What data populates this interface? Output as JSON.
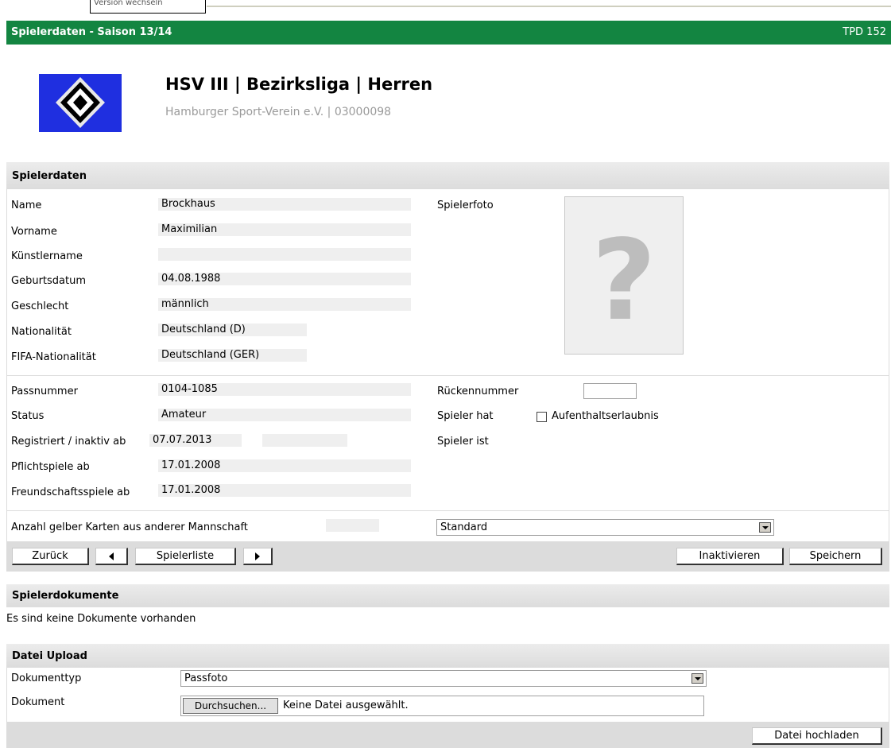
{
  "header": {
    "top_tab_text": "Version wechseln",
    "title": "Spielerdaten - Saison 13/14",
    "code": "TPD 152"
  },
  "club": {
    "name": "HSV III | Bezirksliga | Herren",
    "sub": "Hamburger Sport-Verein e.V. | 03000098"
  },
  "spielerdaten": {
    "heading": "Spielerdaten",
    "fields": {
      "name": {
        "label": "Name",
        "value": "Brockhaus"
      },
      "vorname": {
        "label": "Vorname",
        "value": "Maximilian"
      },
      "kuenstlername": {
        "label": "Künstlername",
        "value": ""
      },
      "geburtsdatum": {
        "label": "Geburtsdatum",
        "value": "04.08.1988"
      },
      "geschlecht": {
        "label": "Geschlecht",
        "value": "männlich"
      },
      "nationalitaet": {
        "label": "Nationalität",
        "value": "Deutschland (D)"
      },
      "fifa_nationalitaet": {
        "label": "FIFA-Nationalität",
        "value": "Deutschland (GER)"
      },
      "passnummer": {
        "label": "Passnummer",
        "value": "0104-1085"
      },
      "status": {
        "label": "Status",
        "value": "Amateur"
      },
      "registriert": {
        "label": "Registriert / inaktiv ab",
        "value": "07.07.2013",
        "value2": ""
      },
      "pflichtspiele": {
        "label": "Pflichtspiele ab",
        "value": "17.01.2008"
      },
      "freundschaftsspiele": {
        "label": "Freundschaftsspiele ab",
        "value": "17.01.2008"
      },
      "gelbe_karten": {
        "label": "Anzahl gelber Karten aus anderer Mannschaft",
        "value": ""
      }
    },
    "spielerfoto_label": "Spielerfoto",
    "photo_placeholder": "?",
    "rueckennummer": {
      "label": "Rückennummer",
      "value": ""
    },
    "spieler_hat": {
      "label": "Spieler hat",
      "checkbox_label": "Aufenthaltserlaubnis",
      "checked": false
    },
    "spieler_ist": {
      "label": "Spieler ist"
    },
    "karten_select": {
      "selected": "Standard"
    }
  },
  "toolbar": {
    "zurueck": "Zurück",
    "spielerliste": "Spielerliste",
    "inaktivieren": "Inaktivieren",
    "speichern": "Speichern"
  },
  "dokumente": {
    "heading": "Spielerdokumente",
    "empty_text": "Es sind keine Dokumente vorhanden"
  },
  "upload": {
    "heading": "Datei Upload",
    "dokumenttyp_label": "Dokumenttyp",
    "dokumenttyp_selected": "Passfoto",
    "dokument_label": "Dokument",
    "browse_button": "Durchsuchen...",
    "file_status": "Keine Datei ausgewählt.",
    "upload_button": "Datei hochladen"
  },
  "colors": {
    "title_bar": "#138541",
    "logo_bg": "#1f2fe0",
    "section_bg": "#dcdcdc"
  }
}
